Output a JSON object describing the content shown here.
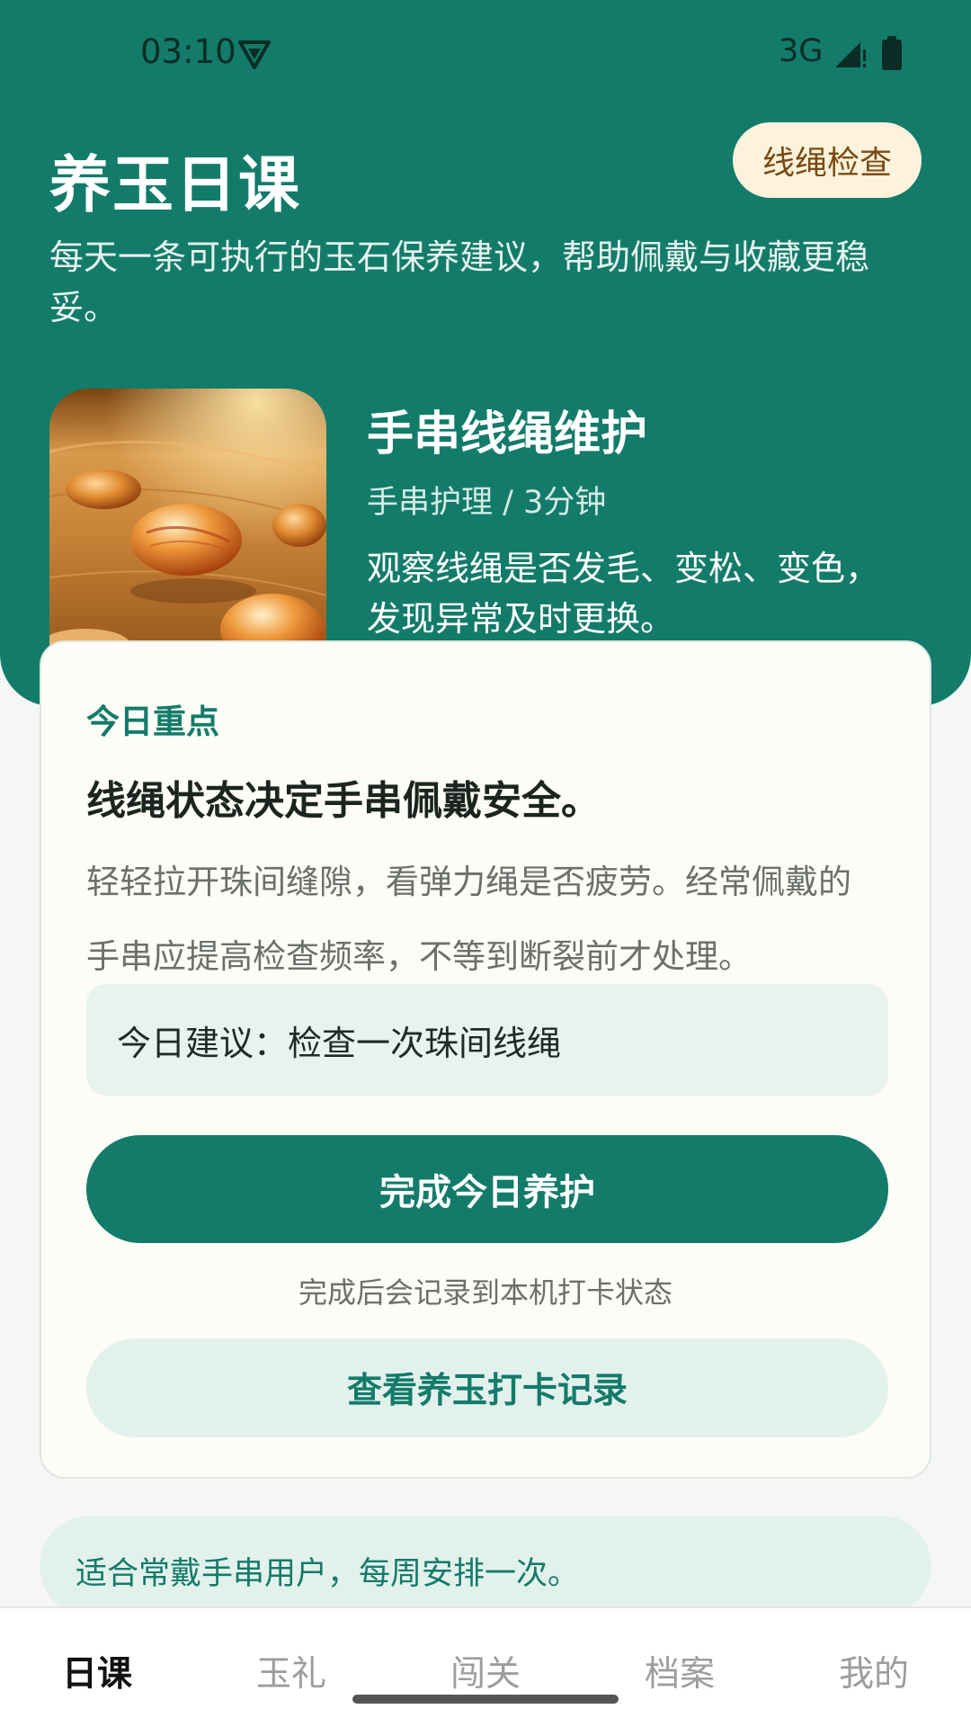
{
  "status_bar": {
    "time": "03:10",
    "network": "3G",
    "icons": [
      "vpn-shield-icon",
      "signal-icon",
      "battery-icon"
    ]
  },
  "header": {
    "title": "养玉日课",
    "check_button": "线绳检查",
    "subtitle": "每天一条可执行的玉石保养建议，帮助佩戴与收藏更稳妥。"
  },
  "feature": {
    "title": "手串线绳维护",
    "meta": "手串护理 / 3分钟",
    "description": "观察线绳是否发毛、变松、变色，发现异常及时更换。"
  },
  "card": {
    "kicker": "今日重点",
    "heading": "线绳状态决定手串佩戴安全。",
    "body": "轻轻拉开珠间缝隙，看弹力绳是否疲劳。经常佩戴的手串应提高检查频率，不等到断裂前才处理。",
    "tip": "今日建议：检查一次珠间线绳",
    "done_button": "完成今日养护",
    "done_note": "完成后会记录到本机打卡状态",
    "records_button": "查看养玉打卡记录"
  },
  "note": "适合常戴手串用户，每周安排一次。",
  "nav": {
    "items": [
      {
        "label": "日课",
        "active": true
      },
      {
        "label": "玉礼",
        "active": false
      },
      {
        "label": "闯关",
        "active": false
      },
      {
        "label": "档案",
        "active": false
      },
      {
        "label": "我的",
        "active": false
      }
    ]
  },
  "colors": {
    "primary": "#137b6a",
    "header_bg": "#137b6a",
    "check_button_bg": "#fdf3dd",
    "check_button_text": "#7a4a12",
    "card_bg": "#fdfcf6",
    "light_accent": "#e3f1ed"
  }
}
